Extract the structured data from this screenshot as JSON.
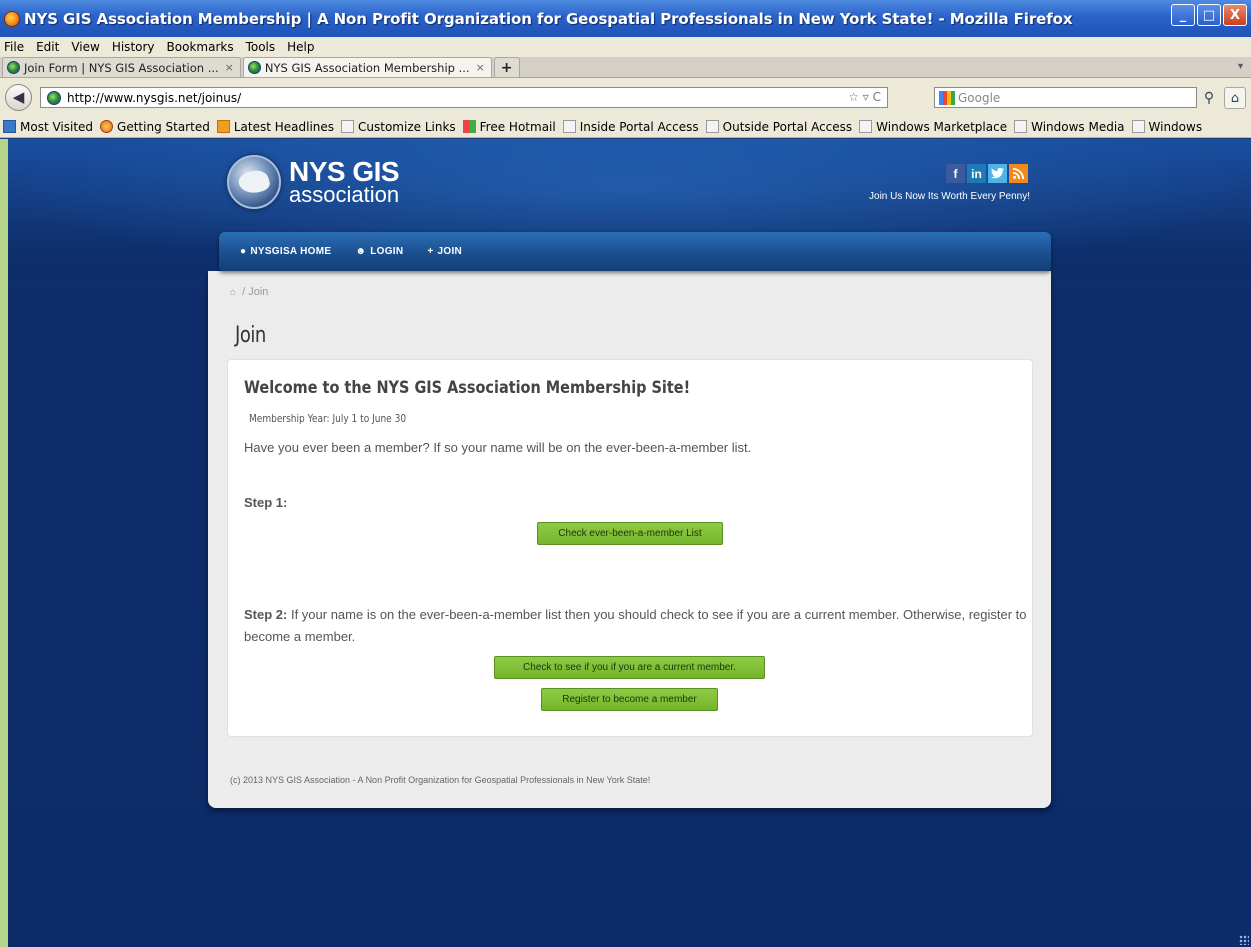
{
  "window": {
    "title": "NYS GIS Association Membership | A Non Profit Organization for Geospatial Professionals in New York State! - Mozilla Firefox",
    "buttons": {
      "minimize": "_",
      "maximize": "□",
      "close": "X"
    }
  },
  "menu": [
    "File",
    "Edit",
    "View",
    "History",
    "Bookmarks",
    "Tools",
    "Help"
  ],
  "tabs": [
    {
      "label": "Join Form | NYS GIS Association ...",
      "close": "×",
      "active": false
    },
    {
      "label": "NYS GIS Association Membership ...",
      "close": "×",
      "active": true
    }
  ],
  "new_tab_label": "+",
  "address_bar": {
    "url": "http://www.nysgis.net/joinus/",
    "tools": "☆ ▿ C"
  },
  "search_bar": {
    "placeholder": "Google"
  },
  "bookmarks": [
    {
      "label": "Most Visited",
      "icon": "blue"
    },
    {
      "label": "Getting Started",
      "icon": "ff"
    },
    {
      "label": "Latest Headlines",
      "icon": "rss"
    },
    {
      "label": "Customize Links",
      "icon": "page"
    },
    {
      "label": "Free Hotmail",
      "icon": "win"
    },
    {
      "label": "Inside Portal Access",
      "icon": "page"
    },
    {
      "label": "Outside Portal Access",
      "icon": "page"
    },
    {
      "label": "Windows Marketplace",
      "icon": "page"
    },
    {
      "label": "Windows Media",
      "icon": "page"
    },
    {
      "label": "Windows",
      "icon": "page"
    }
  ],
  "site": {
    "logo_line1": "NYS GIS",
    "logo_line2": "association",
    "social": {
      "facebook": "f",
      "linkedin": "in",
      "twitter": "t",
      "rss": ")"
    },
    "tagline": "Join Us Now Its Worth Every Penny!",
    "nav": [
      {
        "label": "NYSGISA HOME",
        "icon": "globe-icon"
      },
      {
        "label": "LOGIN",
        "icon": "users-icon"
      },
      {
        "label": "JOIN",
        "icon": "plus-icon"
      }
    ],
    "breadcrumb": "Join",
    "breadcrumb_sep": "/",
    "page_title": "Join"
  },
  "card": {
    "title": "Welcome to the NYS GIS Association Membership Site!",
    "membership_year": "Membership Year: July 1 to June 30",
    "intro": "Have you ever been a member? If so your name will be on the ever-been-a-member list.",
    "step1_label": "Step 1:",
    "check_list_button": "Check ever-been-a-member List",
    "step2_label": "Step 2:",
    "step2_text": " If your name is on the ever-been-a-member list then you should check to see if you are a current member. Otherwise, register to become a member.",
    "check_current_button": "Check to see if you if you are a current member.",
    "register_button": "Register to become a member"
  },
  "footer": "(c) 2013 NYS GIS Association - A Non Profit Organization for Geospatial Professionals in New York State!"
}
